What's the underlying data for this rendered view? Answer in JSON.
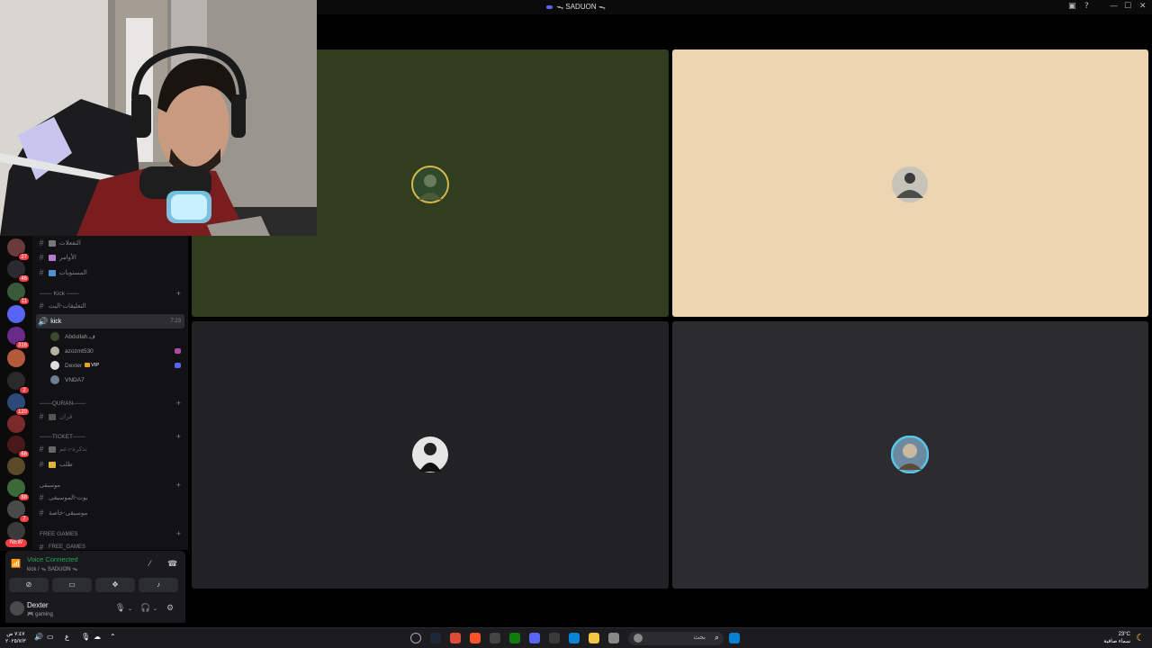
{
  "window": {
    "title": "ᯓ SADUON ᯓ",
    "controls": [
      "▣",
      "?",
      "—",
      "☐",
      "✕"
    ]
  },
  "rail": {
    "servers": [
      {
        "name": "server-1",
        "badge": "27",
        "color": "#6b3b3b"
      },
      {
        "name": "server-2",
        "badge": "46",
        "color": "#2a2a30"
      },
      {
        "name": "server-3",
        "badge": "11",
        "color": "#3a5a3a"
      },
      {
        "name": "server-4",
        "badge": "",
        "color": "#5865f2"
      },
      {
        "name": "server-5",
        "badge": "316",
        "color": "#6a2a8a"
      },
      {
        "name": "server-6",
        "badge": "",
        "color": "#b35a3a"
      },
      {
        "name": "server-7",
        "badge": "2",
        "color": "#2a2a2a"
      },
      {
        "name": "server-8",
        "badge": "120",
        "color": "#2a4a7a"
      },
      {
        "name": "server-9",
        "badge": "",
        "color": "#7a2a2a"
      },
      {
        "name": "server-10",
        "badge": "66",
        "color": "#4a1a1a"
      },
      {
        "name": "server-11",
        "badge": "",
        "color": "#5a4a2a"
      },
      {
        "name": "server-12",
        "badge": "88",
        "color": "#3a6a3a"
      },
      {
        "name": "server-13",
        "badge": "7",
        "color": "#4a4a4a"
      },
      {
        "name": "server-14",
        "badge": "",
        "color": "#3a3a3a"
      }
    ],
    "new_label": "NEW"
  },
  "sidebar": {
    "channels_top": [
      {
        "label": "التفعلات",
        "icon_color": "#777"
      },
      {
        "label": "الأوامر",
        "icon_color": "#b77ad1"
      },
      {
        "label": "المستويات",
        "icon_color": "#4f8fd6"
      }
    ],
    "kick_category": "─── Kick ───",
    "kick_text_channel": "التعليقات-البث",
    "voice_channel": {
      "label": "kick",
      "timer": "7:23"
    },
    "voice_users": [
      {
        "name": "Abdullah.ف",
        "activity": "",
        "vip": ""
      },
      {
        "name": "azozmt530",
        "activity": "#b34aa8",
        "vip": ""
      },
      {
        "name": "Dexter",
        "activity": "#5865f2",
        "vip": "VIP"
      },
      {
        "name": "VNDA7",
        "activity": "",
        "vip": ""
      }
    ],
    "quran_category": "───QURAN───",
    "quran_channels": [
      {
        "label": "قران"
      }
    ],
    "ticket_category": "───TICKET───",
    "ticket_channels": [
      {
        "label": "تذكرة-دعم"
      },
      {
        "label": "طلب"
      }
    ],
    "music_category": "موسيقى",
    "music_channels": [
      {
        "label": "بوت-الموسيقى"
      },
      {
        "label": "موسيقى-خاصة"
      }
    ],
    "freegames_category": "FREE GAMES",
    "freegames_channels": [
      {
        "label": "FREE_GAMES"
      }
    ]
  },
  "voice": {
    "status": "Voice Connected",
    "location": "kick / ᯓ SADUON ᯓ"
  },
  "user": {
    "name": "Dexter",
    "status": "🎮 gaming"
  },
  "tiles": [
    {
      "name": "tile-1",
      "bg": "#323c1f",
      "ring": "#d6b84a"
    },
    {
      "name": "tile-2",
      "bg": "#ecd5b0",
      "ring": ""
    },
    {
      "name": "tile-3",
      "bg": "#222225",
      "ring": ""
    },
    {
      "name": "tile-4",
      "bg": "#2c2c30",
      "ring": "#58c6e6"
    }
  ],
  "taskbar": {
    "clock_time": "٧:٤٧ ص",
    "clock_date": "٢٠٢٥/٧/٣",
    "lang": "ع",
    "search_placeholder": "بحث",
    "weather_temp": "23°C",
    "weather_desc": "سماء صافية",
    "apps": [
      {
        "name": "steam-icon",
        "color": "#1b2838"
      },
      {
        "name": "chrome-icon",
        "color": "#dd4b39"
      },
      {
        "name": "brave-icon",
        "color": "#fb542b"
      },
      {
        "name": "epic-icon",
        "color": "#444"
      },
      {
        "name": "xbox-icon",
        "color": "#107c10"
      },
      {
        "name": "discord-icon",
        "color": "#5865f2"
      },
      {
        "name": "obs-icon",
        "color": "#3a3a3a"
      },
      {
        "name": "store-icon",
        "color": "#0a84d6"
      },
      {
        "name": "explorer-icon",
        "color": "#f2c744"
      },
      {
        "name": "window-icon",
        "color": "#888"
      }
    ]
  }
}
